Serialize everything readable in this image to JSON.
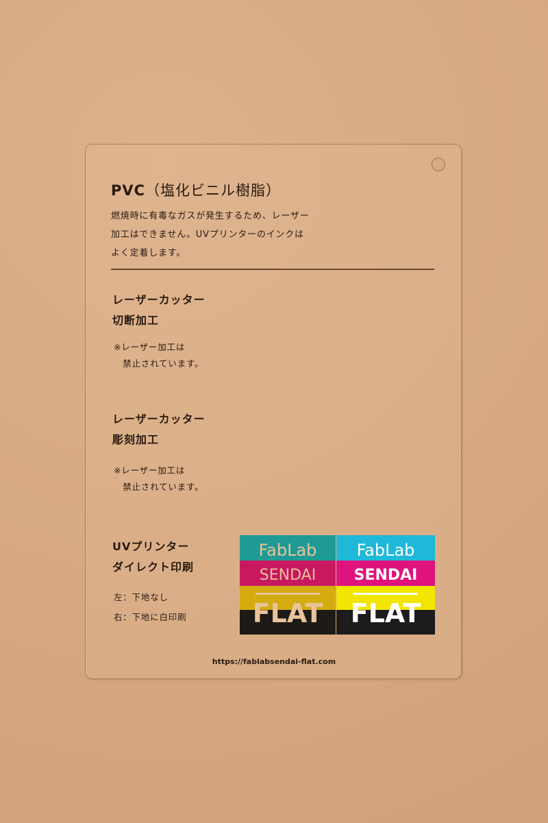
{
  "card": {
    "title": "PVC",
    "title_paren": "（塩化ビニル樹脂）",
    "description": [
      "燃焼時に有毒なガスが発生するため、レーザー",
      "加工はできません。UVプリンターのインクは",
      "よく定着します。"
    ],
    "sections": [
      {
        "heading": [
          "レーザーカッター",
          "切断加工"
        ],
        "note": [
          "※レーザー加工は",
          "　禁止されています。"
        ]
      },
      {
        "heading": [
          "レーザーカッター",
          "彫刻加工"
        ],
        "note": [
          "※レーザー加工は",
          "　禁止されています。"
        ]
      },
      {
        "heading": [
          "UVプリンター",
          "ダイレクト印刷"
        ],
        "note": [
          "左：下地なし",
          "右：下地に白印刷"
        ]
      }
    ],
    "logo": {
      "line1": "FabLab",
      "line2": "SENDAI",
      "line3": "FLAT"
    },
    "url": "https://fablabsendai-flat.com"
  },
  "colors": {
    "cyan": "#1fb8d8",
    "magenta": "#e0127e",
    "yellow": "#f2e600",
    "black": "#1c1c1c",
    "cyan_no_white": "#1f9a95",
    "magenta_no_white": "#c8185e",
    "yellow_no_white": "#d4ac10"
  }
}
